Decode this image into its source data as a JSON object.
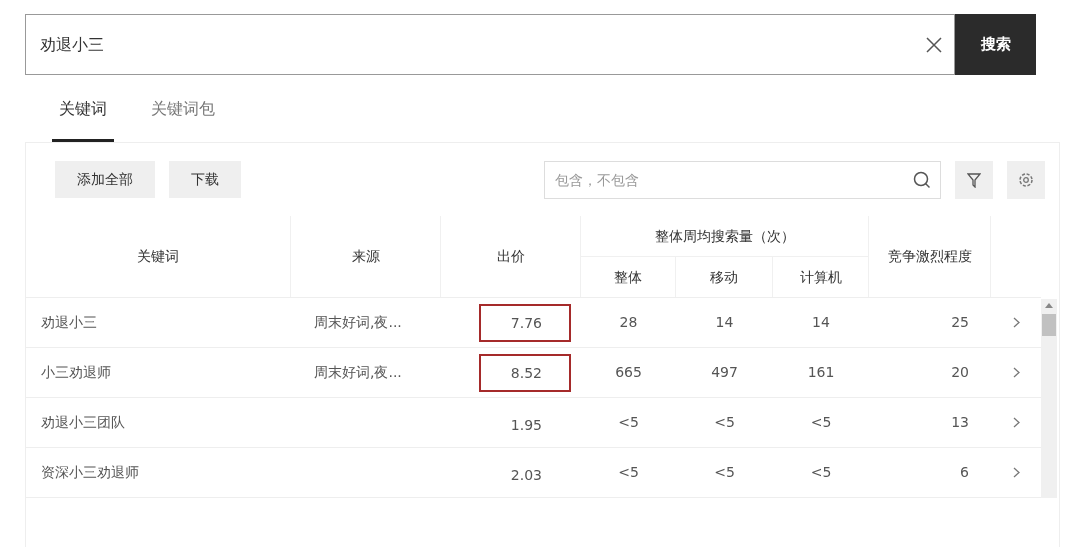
{
  "search": {
    "value": "劝退小三",
    "button": "搜索"
  },
  "tabs": [
    {
      "label": "关键词",
      "selected": true
    },
    {
      "label": "关键词包",
      "selected": false
    }
  ],
  "toolbar": {
    "buttons": [
      "添加全部",
      "下载"
    ],
    "filter": {
      "placeholder": "包含，不包含"
    }
  },
  "table": {
    "columns": [
      "关键词",
      "来源",
      "出价"
    ],
    "group": {
      "label": "整体周均搜索量（次）",
      "columns": [
        "整体",
        "移动",
        "计算机"
      ]
    },
    "last_column": "竞争激烈程度",
    "rows": [
      {
        "keyword": "劝退小三",
        "source": "周末好词,夜...",
        "bid": "7.76",
        "highlighted": true,
        "total": "28",
        "mobile": "14",
        "pc": "14",
        "competition": "25"
      },
      {
        "keyword": "小三劝退师",
        "source": "周末好词,夜...",
        "bid": "8.52",
        "highlighted": true,
        "total": "665",
        "mobile": "497",
        "pc": "161",
        "competition": "20"
      },
      {
        "keyword": "劝退小三团队",
        "bid": "1.95",
        "highlighted": false,
        "total": "<5",
        "mobile": "<5",
        "pc": "<5",
        "competition": "13"
      },
      {
        "keyword": "资深小三劝退师",
        "bid": "2.03",
        "highlighted": false,
        "total": "<5",
        "mobile": "<5",
        "pc": "<5",
        "competition": "6"
      }
    ]
  }
}
